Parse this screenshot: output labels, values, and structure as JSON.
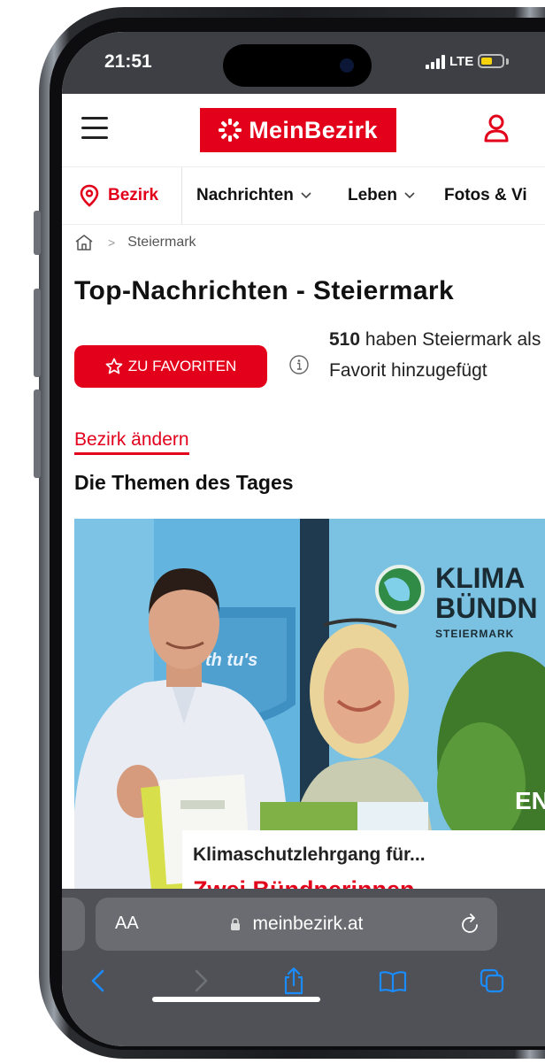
{
  "status_bar": {
    "time": "21:51",
    "network": "LTE"
  },
  "header": {
    "logo_text": "MeinBezirk",
    "brand_color": "#e2001a"
  },
  "nav": {
    "bezirk_label": "Bezirk",
    "items": [
      {
        "label": "Nachrichten"
      },
      {
        "label": "Leben"
      },
      {
        "label": "Fotos & Vi"
      }
    ]
  },
  "breadcrumb": {
    "current": "Steiermark"
  },
  "page": {
    "title": "Top-Nachrichten - Steiermark",
    "favorite_button": "ZU FAVORITEN",
    "favorite_count": "510",
    "favorite_text": "haben Steiermark als Favorit hinzugefügt",
    "change_link": "Bezirk ändern",
    "section_title": "Die Themen des Tages"
  },
  "hero": {
    "banner_line1": "KLIMA",
    "banner_line2": "BÜNDN",
    "banner_line3": "STEIERMARK",
    "sign_text": "th tu's",
    "side_text": "ENK",
    "article_kicker": "Klimaschutzlehrgang für...",
    "article_title": "Zwei Bündnerinnen"
  },
  "safari": {
    "aa_label": "AA",
    "url": "meinbezirk.at"
  }
}
